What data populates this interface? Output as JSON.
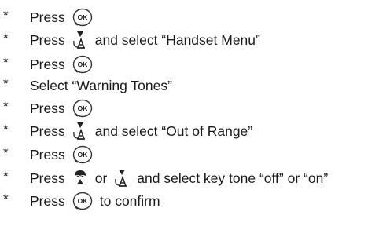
{
  "bullet": "*",
  "steps": [
    {
      "parts": [
        {
          "t": "text",
          "v": "Press"
        },
        {
          "t": "icon",
          "v": "ok-key-icon"
        }
      ]
    },
    {
      "parts": [
        {
          "t": "text",
          "v": "Press"
        },
        {
          "t": "icon",
          "v": "nav-down-key-icon"
        },
        {
          "t": "text",
          "v": "and select  “Handset Menu”"
        }
      ]
    },
    {
      "parts": [
        {
          "t": "text",
          "v": "Press"
        },
        {
          "t": "icon",
          "v": "ok-key-icon"
        }
      ]
    },
    {
      "parts": [
        {
          "t": "text",
          "v": "Select  “Warning Tones”"
        }
      ]
    },
    {
      "parts": [
        {
          "t": "text",
          "v": "Press"
        },
        {
          "t": "icon",
          "v": "ok-key-icon"
        }
      ]
    },
    {
      "parts": [
        {
          "t": "text",
          "v": "Press"
        },
        {
          "t": "icon",
          "v": "nav-down-key-icon"
        },
        {
          "t": "text",
          "v": "and select  “Out of Range”"
        }
      ]
    },
    {
      "parts": [
        {
          "t": "text",
          "v": "Press"
        },
        {
          "t": "icon",
          "v": "ok-key-icon"
        }
      ]
    },
    {
      "parts": [
        {
          "t": "text",
          "v": "Press"
        },
        {
          "t": "icon",
          "v": "nav-up-key-icon"
        },
        {
          "t": "text",
          "v": "or"
        },
        {
          "t": "icon",
          "v": "nav-down-key-icon"
        },
        {
          "t": "text",
          "v": "and select key tone “off” or “on”"
        }
      ]
    },
    {
      "parts": [
        {
          "t": "text",
          "v": "Press"
        },
        {
          "t": "icon",
          "v": "ok-key-icon"
        },
        {
          "t": "text",
          "v": "to confirm"
        }
      ]
    }
  ]
}
